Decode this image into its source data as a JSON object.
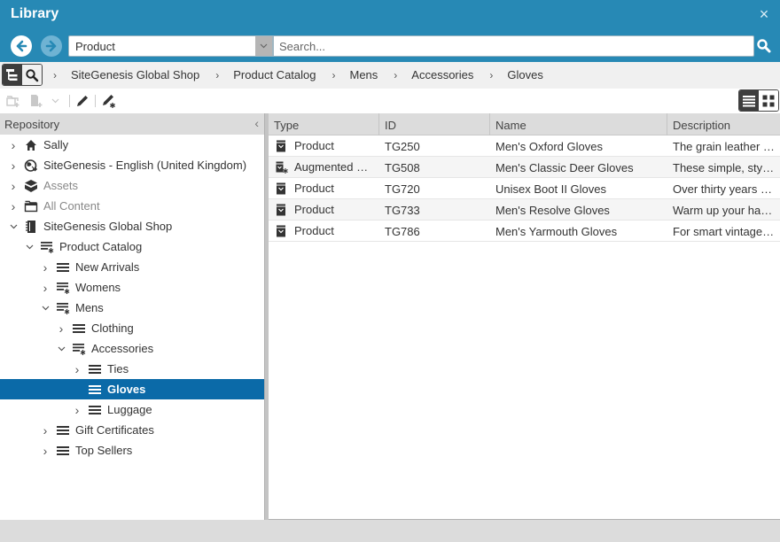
{
  "window": {
    "title": "Library",
    "close_label": "×"
  },
  "nav": {
    "back_icon": "arrow-left-circle",
    "forward_icon": "arrow-right-circle",
    "type_filter": {
      "value": "Product"
    },
    "search": {
      "placeholder": "Search..."
    }
  },
  "breadcrumb": {
    "items": [
      "SiteGenesis Global Shop",
      "Product Catalog",
      "Mens",
      "Accessories",
      "Gloves"
    ],
    "separator": "›"
  },
  "sidebar": {
    "header": "Repository",
    "collapse_glyph": "‹",
    "tree": [
      {
        "label": "Sally",
        "icon": "home-icon",
        "level": 0,
        "state": "collapsed"
      },
      {
        "label": "SiteGenesis - English (United Kingdom)",
        "icon": "site-icon",
        "level": 0,
        "state": "collapsed"
      },
      {
        "label": "Assets",
        "icon": "assets-icon",
        "level": 0,
        "state": "collapsed",
        "muted": true
      },
      {
        "label": "All Content",
        "icon": "folder-icon",
        "level": 0,
        "state": "collapsed",
        "muted": true
      },
      {
        "label": "SiteGenesis Global Shop",
        "icon": "store-icon",
        "level": 0,
        "state": "expanded"
      },
      {
        "label": "Product Catalog",
        "icon": "augmented-category-icon",
        "level": 1,
        "state": "expanded"
      },
      {
        "label": "New Arrivals",
        "icon": "category-icon",
        "level": 2,
        "state": "collapsed"
      },
      {
        "label": "Womens",
        "icon": "augmented-category-icon",
        "level": 2,
        "state": "collapsed"
      },
      {
        "label": "Mens",
        "icon": "augmented-category-icon",
        "level": 2,
        "state": "expanded"
      },
      {
        "label": "Clothing",
        "icon": "category-icon",
        "level": 3,
        "state": "collapsed"
      },
      {
        "label": "Accessories",
        "icon": "augmented-category-icon",
        "level": 3,
        "state": "expanded"
      },
      {
        "label": "Ties",
        "icon": "category-icon",
        "level": 4,
        "state": "collapsed"
      },
      {
        "label": "Gloves",
        "icon": "category-icon",
        "level": 4,
        "state": "leaf",
        "selected": true
      },
      {
        "label": "Luggage",
        "icon": "category-icon",
        "level": 4,
        "state": "collapsed"
      },
      {
        "label": "Gift Certificates",
        "icon": "category-icon",
        "level": 2,
        "state": "collapsed"
      },
      {
        "label": "Top Sellers",
        "icon": "category-icon",
        "level": 2,
        "state": "collapsed"
      }
    ]
  },
  "grid": {
    "columns": [
      "Type",
      "ID",
      "Name",
      "Description"
    ],
    "rows": [
      {
        "type": "Product",
        "type_icon": "product-icon",
        "id": "TG250",
        "name": "Men's Oxford Gloves",
        "description": "The grain leather g..."
      },
      {
        "type": "Augmented Pr...",
        "type_icon": "augmented-product-icon",
        "id": "TG508",
        "name": "Men's Classic Deer Gloves",
        "description": "These simple, styli..."
      },
      {
        "type": "Product",
        "type_icon": "product-icon",
        "id": "TG720",
        "name": "Unisex Boot II Gloves",
        "description": "Over thirty years a..."
      },
      {
        "type": "Product",
        "type_icon": "product-icon",
        "id": "TG733",
        "name": "Men's Resolve Gloves",
        "description": "Warm up your han..."
      },
      {
        "type": "Product",
        "type_icon": "product-icon",
        "id": "TG786",
        "name": "Men's Yarmouth Gloves",
        "description": "For smart vintage ..."
      }
    ]
  },
  "colors": {
    "header_bg": "#2789b5",
    "selection": "#0b6aa8",
    "panel_gray": "#dcdcdc"
  }
}
